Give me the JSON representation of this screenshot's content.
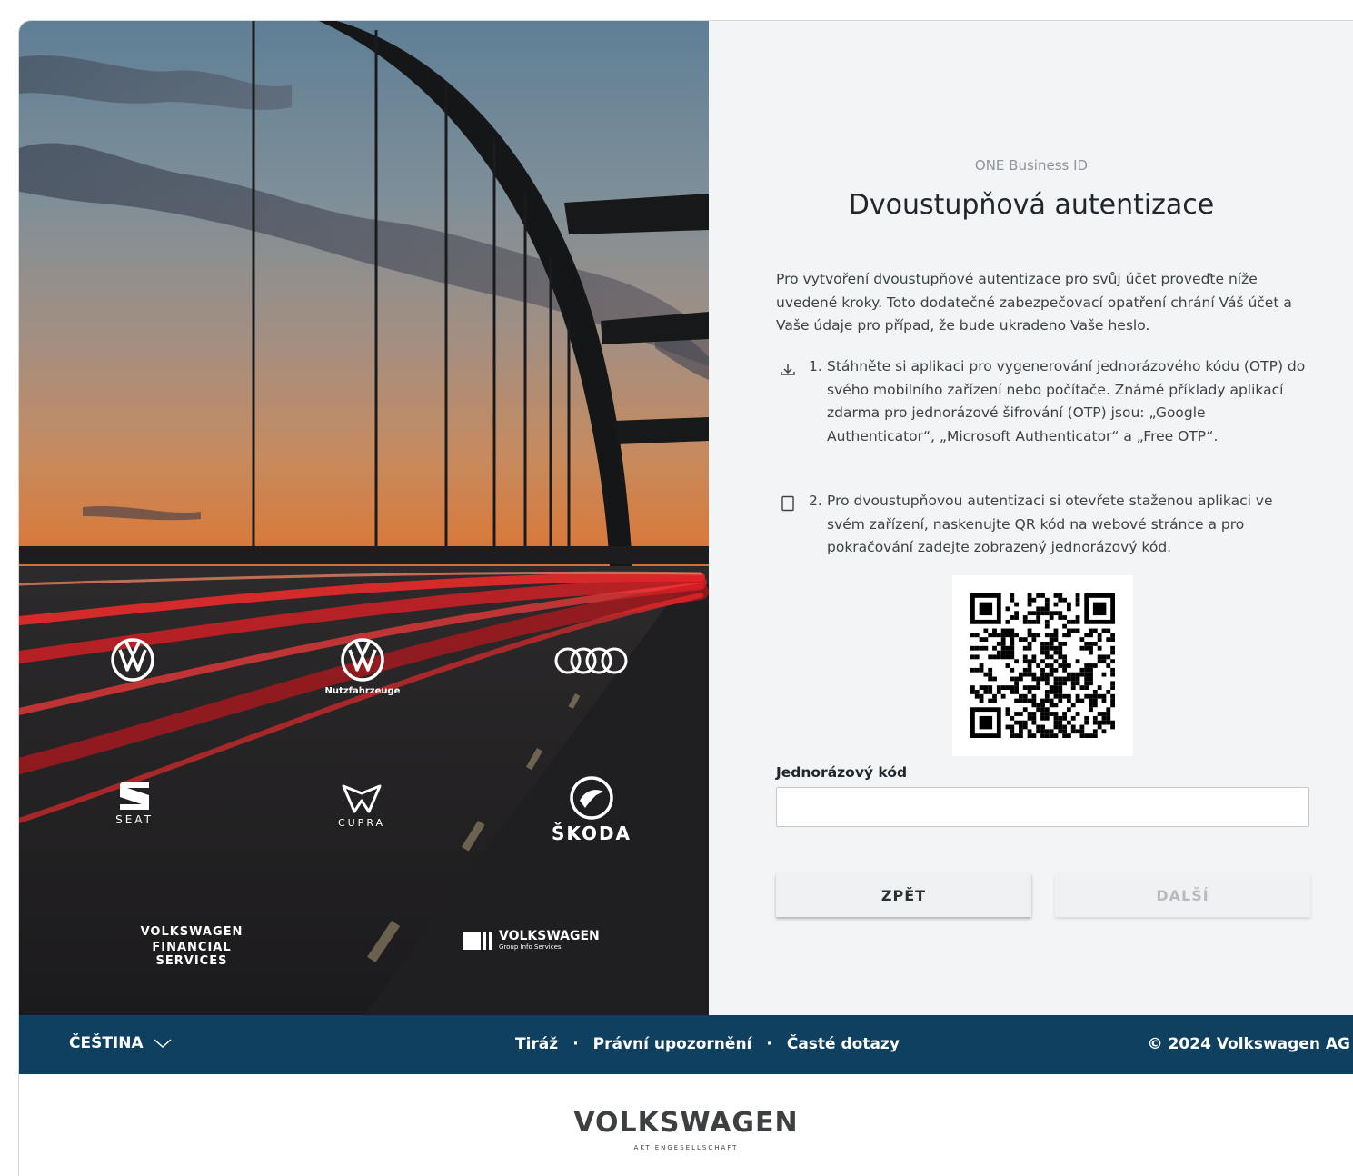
{
  "hero": {
    "brands": {
      "vw_commercial_label": "Nutzfahrzeuge",
      "seat_label": "SEAT",
      "cupra_label": "CUPRA",
      "skoda_label": "ŠKODA",
      "vwfs_line1": "VOLKSWAGEN",
      "vwfs_line2": "FINANCIAL SERVICES",
      "vwgis_line1": "VOLKSWAGEN",
      "vwgis_line2": "Group Info Services"
    }
  },
  "panel": {
    "product": "ONE Business ID",
    "title": "Dvoustupňová autentizace",
    "intro": "Pro vytvoření dvoustupňové autentizace pro svůj účet proveďte níže uvedené kroky. Toto dodatečné zabezpečovací opatření chrání Váš účet a Vaše údaje pro případ, že bude ukradeno Vaše heslo.",
    "steps": [
      {
        "number": "1.",
        "icon": "download-icon",
        "text": "Stáhněte si aplikaci pro vygenerování jednorázového kódu (OTP) do svého mobilního zařízení nebo počítače. Známé příklady aplikací zdarma pro jednorázové šifrování (OTP) jsou: „Google Authenticator“, „Microsoft Authenticator“ a „Free OTP“."
      },
      {
        "number": "2.",
        "icon": "mobile-device-icon",
        "text": "Pro dvoustupňovou autentizaci si otevřete staženou aplikaci ve svém zařízení, naskenujte QR kód na webové stránce a pro pokračování zadejte zobrazený jednorázový kód."
      }
    ],
    "otp_label": "Jednorázový kód",
    "otp_value": "",
    "back_label": "ZPĚT",
    "next_label": "DALŠÍ"
  },
  "footer": {
    "language": "ČEŠTINA",
    "links": [
      "Tiráž",
      "Právní upozornění",
      "Časté dotazy"
    ],
    "separator": "·",
    "copyright": "© 2024 Volkswagen AG"
  },
  "bottom_logo": {
    "word": "VOLKSWAGEN",
    "sub": "AKTIENGESELLSCHAFT"
  },
  "colors": {
    "footer_bg": "#0f405f",
    "panel_bg": "#f3f4f5",
    "title_text": "#20262b",
    "disabled_button_text": "#b7bbbf"
  }
}
